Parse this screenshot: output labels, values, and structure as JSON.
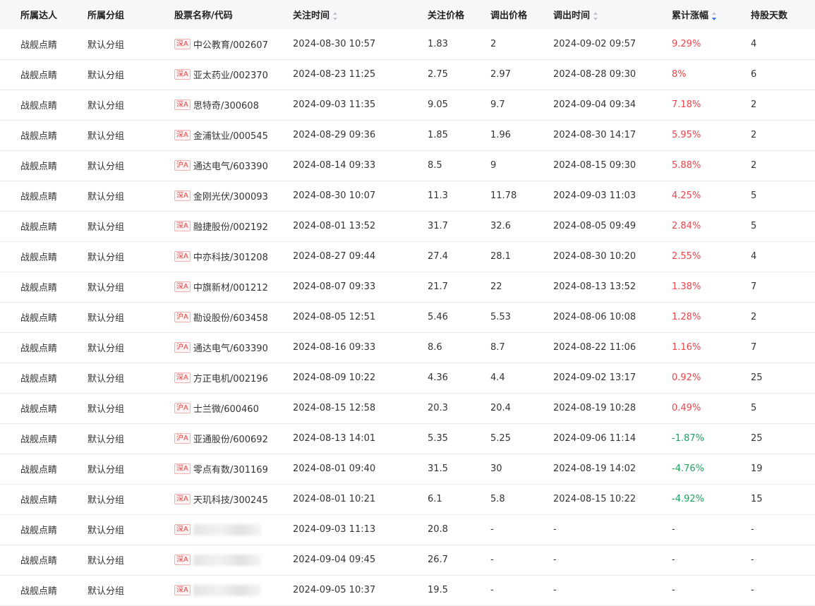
{
  "headers": {
    "daren": "所属达人",
    "group": "所属分组",
    "stock": "股票名称/代码",
    "watch_time": "关注时间",
    "watch_price": "关注价格",
    "out_price": "调出价格",
    "out_time": "调出时间",
    "change": "累计涨幅",
    "days": "持股天数"
  },
  "sort": {
    "active_column": "累计涨幅",
    "direction": "descending",
    "active_color": "#3b6fe0"
  },
  "colors": {
    "positive": "#f0464b",
    "negative": "#1aa35c",
    "market_badge": "#e64545"
  },
  "rows": [
    {
      "daren": "战舰点睛",
      "group": "默认分组",
      "market": "深A",
      "stock": "中公教育/002607",
      "watch_time": "2024-08-30 10:57",
      "watch_price": "1.83",
      "out_price": "2",
      "out_time": "2024-09-02 09:57",
      "change": "9.29%",
      "dir": "up",
      "days": "4"
    },
    {
      "daren": "战舰点睛",
      "group": "默认分组",
      "market": "深A",
      "stock": "亚太药业/002370",
      "watch_time": "2024-08-23 11:25",
      "watch_price": "2.75",
      "out_price": "2.97",
      "out_time": "2024-08-28 09:30",
      "change": "8%",
      "dir": "up",
      "days": "6"
    },
    {
      "daren": "战舰点睛",
      "group": "默认分组",
      "market": "深A",
      "stock": "思特奇/300608",
      "watch_time": "2024-09-03 11:35",
      "watch_price": "9.05",
      "out_price": "9.7",
      "out_time": "2024-09-04 09:34",
      "change": "7.18%",
      "dir": "up",
      "days": "2"
    },
    {
      "daren": "战舰点睛",
      "group": "默认分组",
      "market": "深A",
      "stock": "金浦钛业/000545",
      "watch_time": "2024-08-29 09:36",
      "watch_price": "1.85",
      "out_price": "1.96",
      "out_time": "2024-08-30 14:17",
      "change": "5.95%",
      "dir": "up",
      "days": "2"
    },
    {
      "daren": "战舰点睛",
      "group": "默认分组",
      "market": "沪A",
      "stock": "通达电气/603390",
      "watch_time": "2024-08-14 09:33",
      "watch_price": "8.5",
      "out_price": "9",
      "out_time": "2024-08-15 09:30",
      "change": "5.88%",
      "dir": "up",
      "days": "2"
    },
    {
      "daren": "战舰点睛",
      "group": "默认分组",
      "market": "深A",
      "stock": "金刚光伏/300093",
      "watch_time": "2024-08-30 10:07",
      "watch_price": "11.3",
      "out_price": "11.78",
      "out_time": "2024-09-03 11:03",
      "change": "4.25%",
      "dir": "up",
      "days": "5"
    },
    {
      "daren": "战舰点睛",
      "group": "默认分组",
      "market": "深A",
      "stock": "融捷股份/002192",
      "watch_time": "2024-08-01 13:52",
      "watch_price": "31.7",
      "out_price": "32.6",
      "out_time": "2024-08-05 09:49",
      "change": "2.84%",
      "dir": "up",
      "days": "5"
    },
    {
      "daren": "战舰点睛",
      "group": "默认分组",
      "market": "深A",
      "stock": "中亦科技/301208",
      "watch_time": "2024-08-27 09:44",
      "watch_price": "27.4",
      "out_price": "28.1",
      "out_time": "2024-08-30 10:20",
      "change": "2.55%",
      "dir": "up",
      "days": "4"
    },
    {
      "daren": "战舰点睛",
      "group": "默认分组",
      "market": "深A",
      "stock": "中旗新材/001212",
      "watch_time": "2024-08-07 09:33",
      "watch_price": "21.7",
      "out_price": "22",
      "out_time": "2024-08-13 13:52",
      "change": "1.38%",
      "dir": "up",
      "days": "7"
    },
    {
      "daren": "战舰点睛",
      "group": "默认分组",
      "market": "沪A",
      "stock": "勘设股份/603458",
      "watch_time": "2024-08-05 12:51",
      "watch_price": "5.46",
      "out_price": "5.53",
      "out_time": "2024-08-06 10:08",
      "change": "1.28%",
      "dir": "up",
      "days": "2"
    },
    {
      "daren": "战舰点睛",
      "group": "默认分组",
      "market": "沪A",
      "stock": "通达电气/603390",
      "watch_time": "2024-08-16 09:33",
      "watch_price": "8.6",
      "out_price": "8.7",
      "out_time": "2024-08-22 11:06",
      "change": "1.16%",
      "dir": "up",
      "days": "7"
    },
    {
      "daren": "战舰点睛",
      "group": "默认分组",
      "market": "深A",
      "stock": "方正电机/002196",
      "watch_time": "2024-08-09 10:22",
      "watch_price": "4.36",
      "out_price": "4.4",
      "out_time": "2024-09-02 13:17",
      "change": "0.92%",
      "dir": "up",
      "days": "25"
    },
    {
      "daren": "战舰点睛",
      "group": "默认分组",
      "market": "沪A",
      "stock": "士兰微/600460",
      "watch_time": "2024-08-15 12:58",
      "watch_price": "20.3",
      "out_price": "20.4",
      "out_time": "2024-08-19 10:28",
      "change": "0.49%",
      "dir": "up",
      "days": "5"
    },
    {
      "daren": "战舰点睛",
      "group": "默认分组",
      "market": "沪A",
      "stock": "亚通股份/600692",
      "watch_time": "2024-08-13 14:01",
      "watch_price": "5.35",
      "out_price": "5.25",
      "out_time": "2024-09-06 11:14",
      "change": "-1.87%",
      "dir": "down",
      "days": "25"
    },
    {
      "daren": "战舰点睛",
      "group": "默认分组",
      "market": "深A",
      "stock": "零点有数/301169",
      "watch_time": "2024-08-01 09:40",
      "watch_price": "31.5",
      "out_price": "30",
      "out_time": "2024-08-19 14:02",
      "change": "-4.76%",
      "dir": "down",
      "days": "19"
    },
    {
      "daren": "战舰点睛",
      "group": "默认分组",
      "market": "深A",
      "stock": "天玑科技/300245",
      "watch_time": "2024-08-01 10:21",
      "watch_price": "6.1",
      "out_price": "5.8",
      "out_time": "2024-08-15 10:22",
      "change": "-4.92%",
      "dir": "down",
      "days": "15"
    },
    {
      "daren": "战舰点睛",
      "group": "默认分组",
      "market": "深A",
      "stock": "",
      "blurred": true,
      "watch_time": "2024-09-03 11:13",
      "watch_price": "20.8",
      "out_price": "-",
      "out_time": "-",
      "change": "-",
      "dir": "none",
      "days": "-"
    },
    {
      "daren": "战舰点睛",
      "group": "默认分组",
      "market": "深A",
      "stock": "",
      "blurred": true,
      "watch_time": "2024-09-04 09:45",
      "watch_price": "26.7",
      "out_price": "-",
      "out_time": "-",
      "change": "-",
      "dir": "none",
      "days": "-"
    },
    {
      "daren": "战舰点睛",
      "group": "默认分组",
      "market": "深A",
      "stock": "",
      "blurred": true,
      "watch_time": "2024-09-05 10:37",
      "watch_price": "19.5",
      "out_price": "-",
      "out_time": "-",
      "change": "-",
      "dir": "none",
      "days": "-"
    }
  ]
}
